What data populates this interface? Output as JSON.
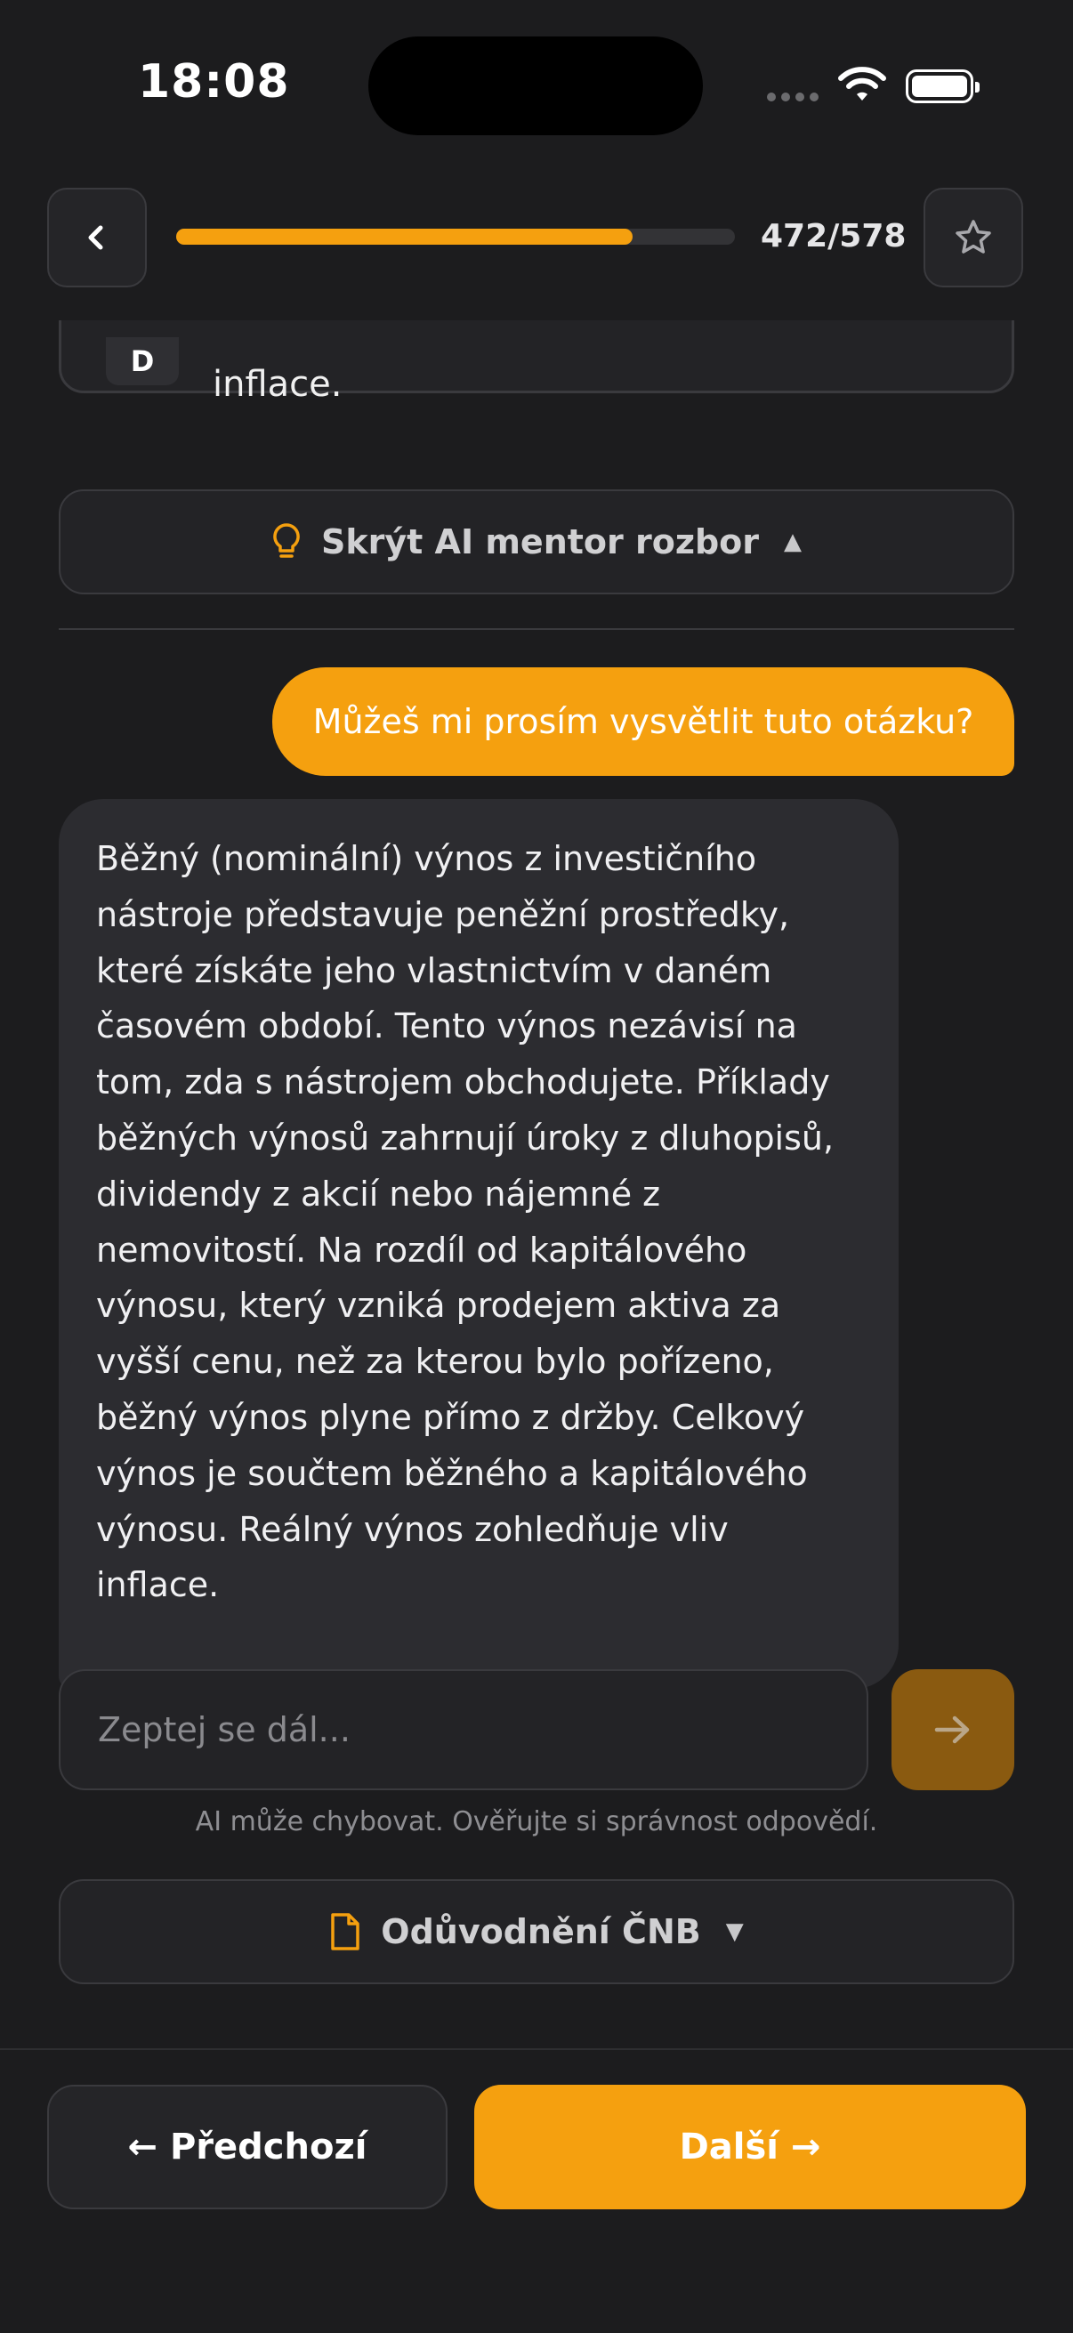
{
  "status_bar": {
    "time": "18:08"
  },
  "header": {
    "progress_value": 472,
    "progress_total": 578,
    "progress_label": "472/578",
    "accent_color": "#f5a00f",
    "back_icon": "chevron-left-icon",
    "star_icon": "star-outline-icon"
  },
  "answer_option": {
    "letter": "D",
    "text_tail": "inflace."
  },
  "ai_mentor": {
    "toggle_label": "Skrýt AI mentor rozbor",
    "icon": "lightbulb-icon"
  },
  "chat": {
    "user_message": "Můžeš mi prosím vysvětlit tuto otázku?",
    "ai_lines": [
      "Běžný (nominální) výnos z investičního",
      "nástroje představuje peněžní prostředky,",
      "které získáte jeho vlastnictvím v daném",
      "časovém období. Tento výnos nezávisí na",
      "tom, zda s nástrojem obchodujete. Příklady",
      "běžných výnosů zahrnují úroky z dluhopisů,",
      "dividendy z akcií nebo nájemné z",
      "nemovitostí. Na rozdíl od kapitálového",
      "výnosu, který vzniká prodejem aktiva za",
      "vyšší cenu, než za kterou bylo pořízeno,",
      "běžný výnos plyne přímo z držby. Celkový",
      "výnos je součtem běžného a kapitálového",
      "výnosu. Reálný výnos zohledňuje vliv",
      "inflace."
    ],
    "input_placeholder": "Zeptej se dál...",
    "input_value": "",
    "disclaimer": "AI může chybovat. Ověřujte si správnost odpovědí."
  },
  "cnb": {
    "toggle_label": "Odůvodnění ČNB",
    "icon": "document-icon"
  },
  "footer": {
    "prev_label": "← Předchozí",
    "next_label": "Další →"
  }
}
